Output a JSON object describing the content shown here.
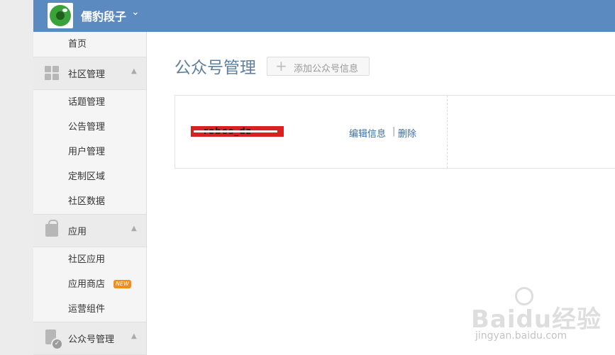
{
  "header": {
    "brand": "儒豹段子"
  },
  "sidebar": {
    "home": "首页",
    "sections": [
      {
        "title": "社区管理",
        "items": [
          "话题管理",
          "公告管理",
          "用户管理",
          "定制区域",
          "社区数据"
        ]
      },
      {
        "title": "应用",
        "items": [
          "社区应用",
          "应用商店",
          "运营组件"
        ],
        "badge": "NEW"
      },
      {
        "title": "公众号管理"
      }
    ]
  },
  "main": {
    "title": "公众号管理",
    "add_button": "添加公众号信息",
    "account": {
      "name": "robos_dz",
      "edit": "编辑信息",
      "separator": "|",
      "delete": "删除"
    }
  },
  "watermark": {
    "main": "Baidu经验",
    "sub": "jingyan.baidu.com"
  }
}
